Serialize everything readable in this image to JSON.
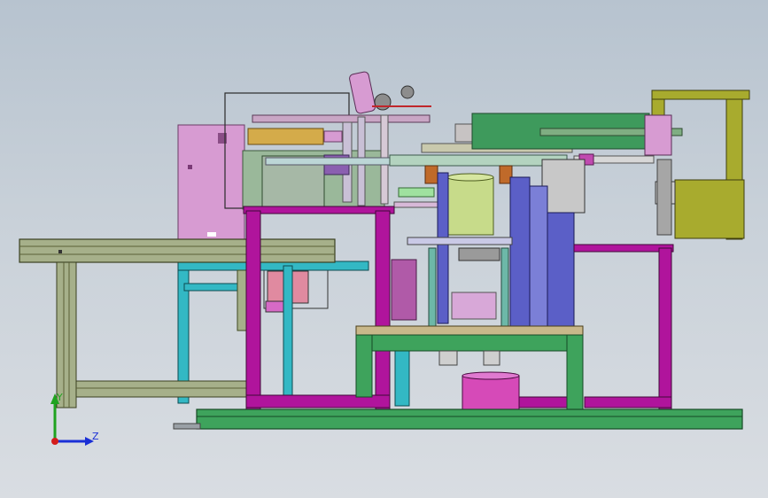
{
  "viewport": {
    "background_top": "#b7c3cf",
    "background_bottom": "#d9dde2"
  },
  "triad": {
    "y_label": "Y",
    "z_label": "Z",
    "y_color": "#1fa31f",
    "z_color": "#1a2fd6",
    "x_color": "#d41c1c"
  },
  "colors": {
    "conveyor": "#a6b08a",
    "magenta_frame": "#b0149c",
    "green_table": "#3ea35c",
    "cyan_frame": "#33b8c4",
    "pink_panel": "#d99ad4",
    "olive_box": "#a8ab2e",
    "blue_column": "#5b5fc7",
    "pale_green": "#a6d9a0"
  }
}
